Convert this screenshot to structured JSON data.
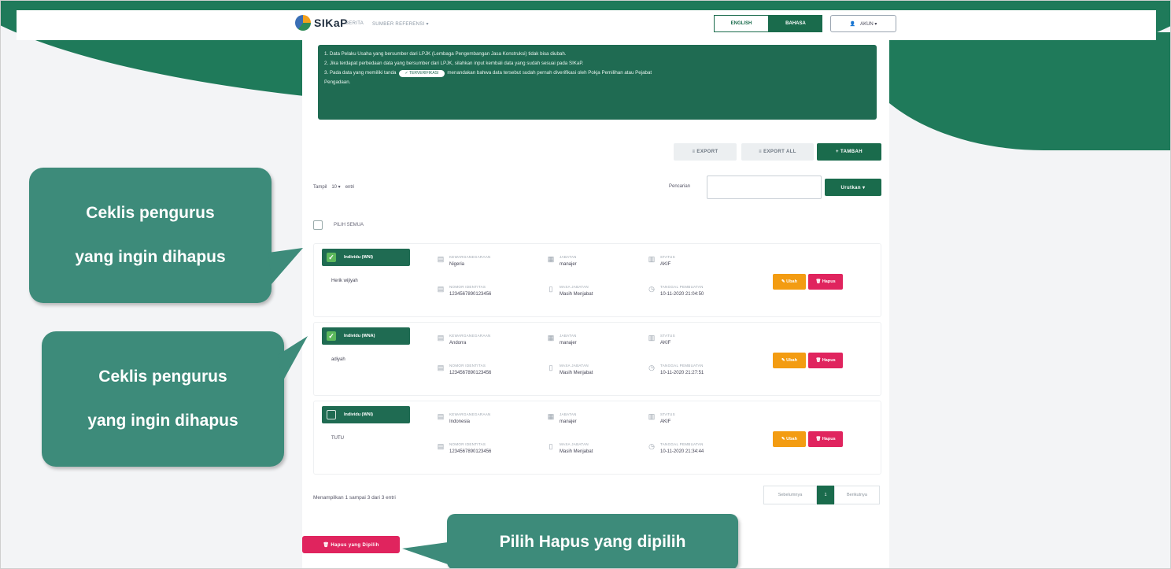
{
  "navbar": {
    "logo_text": "SIKaP",
    "nav_items": [
      "BERITA",
      "SUMBER REFERENSI ▾"
    ],
    "lang_en": "ENGLISH",
    "lang_id": "BAHASA",
    "account_label": "AKUN ▾"
  },
  "notice": {
    "lines": [
      "1. Data Pelaku Usaha yang bersumber dari LPJK (Lembaga Pengembangan Jasa Konstruksi) tidak bisa diubah.",
      "2. Jika terdapat perbedaan data yang bersumber dari LPJK, silahkan input kembali data yang sudah sesuai pada SIKaP.",
      "3. Pada data yang memiliki tanda",
      "menandakan bahwa data tersebut sudah pernah diverifikasi oleh Pokja Pemilihan atau Pejabat",
      "Pengadaan."
    ],
    "badge": "✓ TERVERIFIKASI"
  },
  "toolbar": {
    "export_label": "≡ EXPORT",
    "export_all_label": "≡ EXPORT ALL",
    "tambah_label": "+ TAMBAH",
    "tampil_label": "Tampil",
    "tampil_value": "10 ▾",
    "entri_label": "entri",
    "pencarian_label": "Pencarian",
    "urutkan_label": "Urutkan ▾"
  },
  "pilih_semua_label": "PILIH SEMUA",
  "rows": [
    {
      "tag": "Individu (WNI)",
      "checked": true,
      "name": "Herik wijiyah",
      "kewarganegaraan_label": "KEWARGANEGARAAN",
      "kewarganegaraan": "Nigeria",
      "jabatan_label": "JABATAN",
      "jabatan": "manajer",
      "status_label": "STATUS",
      "status": "AKIF",
      "identitas_label": "NOMOR IDENTITAS",
      "identitas": "1234567890123456",
      "masa_label": "MASA JABATAN",
      "masa": "Masih Menjabat",
      "tanggal_label": "TANGGAL PEMBUATAN",
      "tanggal": "10-11-2020 21:04:50",
      "ubah": "✎ Ubah",
      "hapus": "🗑 Hapus"
    },
    {
      "tag": "Individu (WNA)",
      "checked": true,
      "name": "adiyah",
      "kewarganegaraan_label": "KEWARGANEGARAAN",
      "kewarganegaraan": "Andorra",
      "jabatan_label": "JABATAN",
      "jabatan": "manajer",
      "status_label": "STATUS",
      "status": "AKIF",
      "identitas_label": "NOMOR IDENTITAS",
      "identitas": "1234567890123456",
      "masa_label": "MASA JABATAN",
      "masa": "Masih Menjabat",
      "tanggal_label": "TANGGAL PEMBUATAN",
      "tanggal": "10-11-2020 21:27:51",
      "ubah": "✎ Ubah",
      "hapus": "🗑 Hapus"
    },
    {
      "tag": "Individu (WNI)",
      "checked": false,
      "name": "TUTU",
      "kewarganegaraan_label": "KEWARGANEGARAAN",
      "kewarganegaraan": "Indonesia",
      "jabatan_label": "JABATAN",
      "jabatan": "manajer",
      "status_label": "STATUS",
      "status": "AKIF",
      "identitas_label": "NOMOR IDENTITAS",
      "identitas": "1234567890123456",
      "masa_label": "MASA JABATAN",
      "masa": "Masih Menjabat",
      "tanggal_label": "TANGGAL PEMBUATAN",
      "tanggal": "10-11-2020 21:34:44",
      "ubah": "✎ Ubah",
      "hapus": "🗑 Hapus"
    }
  ],
  "footer": {
    "menampilkan": "Menampilkan 1 sampai 3 dari 3 entri",
    "prev": "Sebelumnya",
    "page": "1",
    "next": "Berikutnya",
    "hapus_dipilih": "🗑 Hapus yang Dipilih"
  },
  "callouts": {
    "c1_line1": "Ceklis pengurus",
    "c1_line2": "yang ingin dihapus",
    "c2_line1": "Ceklis pengurus",
    "c2_line2": "yang ingin dihapus",
    "c3": "Pilih Hapus yang dipilih"
  },
  "colors": {
    "brand_green": "#1f6b52",
    "callout_teal": "#3d8b7a",
    "danger": "#e0245e",
    "warning": "#f39c12"
  }
}
